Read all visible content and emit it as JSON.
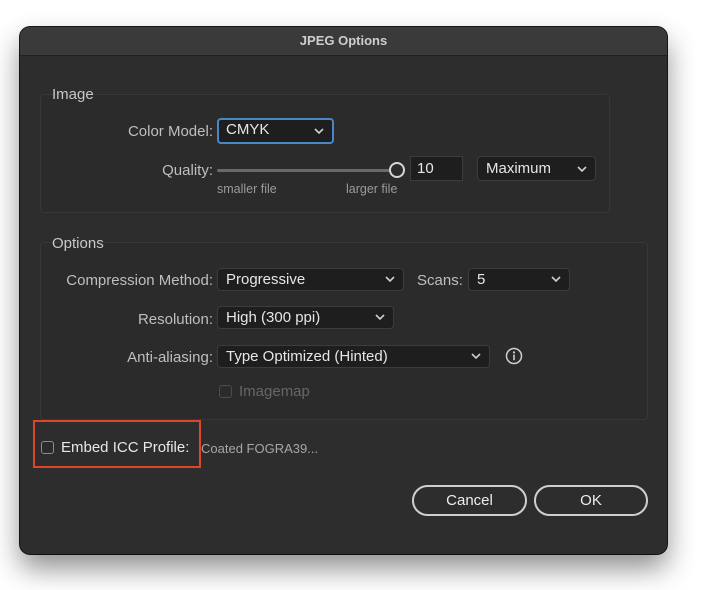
{
  "window": {
    "title": "JPEG Options"
  },
  "image_group": {
    "title": "Image",
    "color_model_label": "Color Model:",
    "color_model_value": "CMYK",
    "quality_label": "Quality:",
    "quality_value": "10",
    "quality_preset": "Maximum",
    "slider_min_label": "smaller file",
    "slider_max_label": "larger file",
    "slider_level": 1.0
  },
  "options_group": {
    "title": "Options",
    "compression_label": "Compression Method:",
    "compression_value": "Progressive",
    "scans_label": "Scans:",
    "scans_value": "5",
    "resolution_label": "Resolution:",
    "resolution_value": "High (300 ppi)",
    "antialiasing_label": "Anti-aliasing:",
    "antialiasing_value": "Type Optimized (Hinted)",
    "imagemap_label": "Imagemap",
    "imagemap_checked": false,
    "imagemap_enabled": false
  },
  "icc": {
    "label": "Embed ICC Profile:",
    "profile": "Coated FOGRA39...",
    "checked": false
  },
  "buttons": {
    "cancel": "Cancel",
    "ok": "OK"
  },
  "colors": {
    "highlight": "#e0442b",
    "focus": "#4a86c8",
    "panel": "#2d2d2d"
  }
}
